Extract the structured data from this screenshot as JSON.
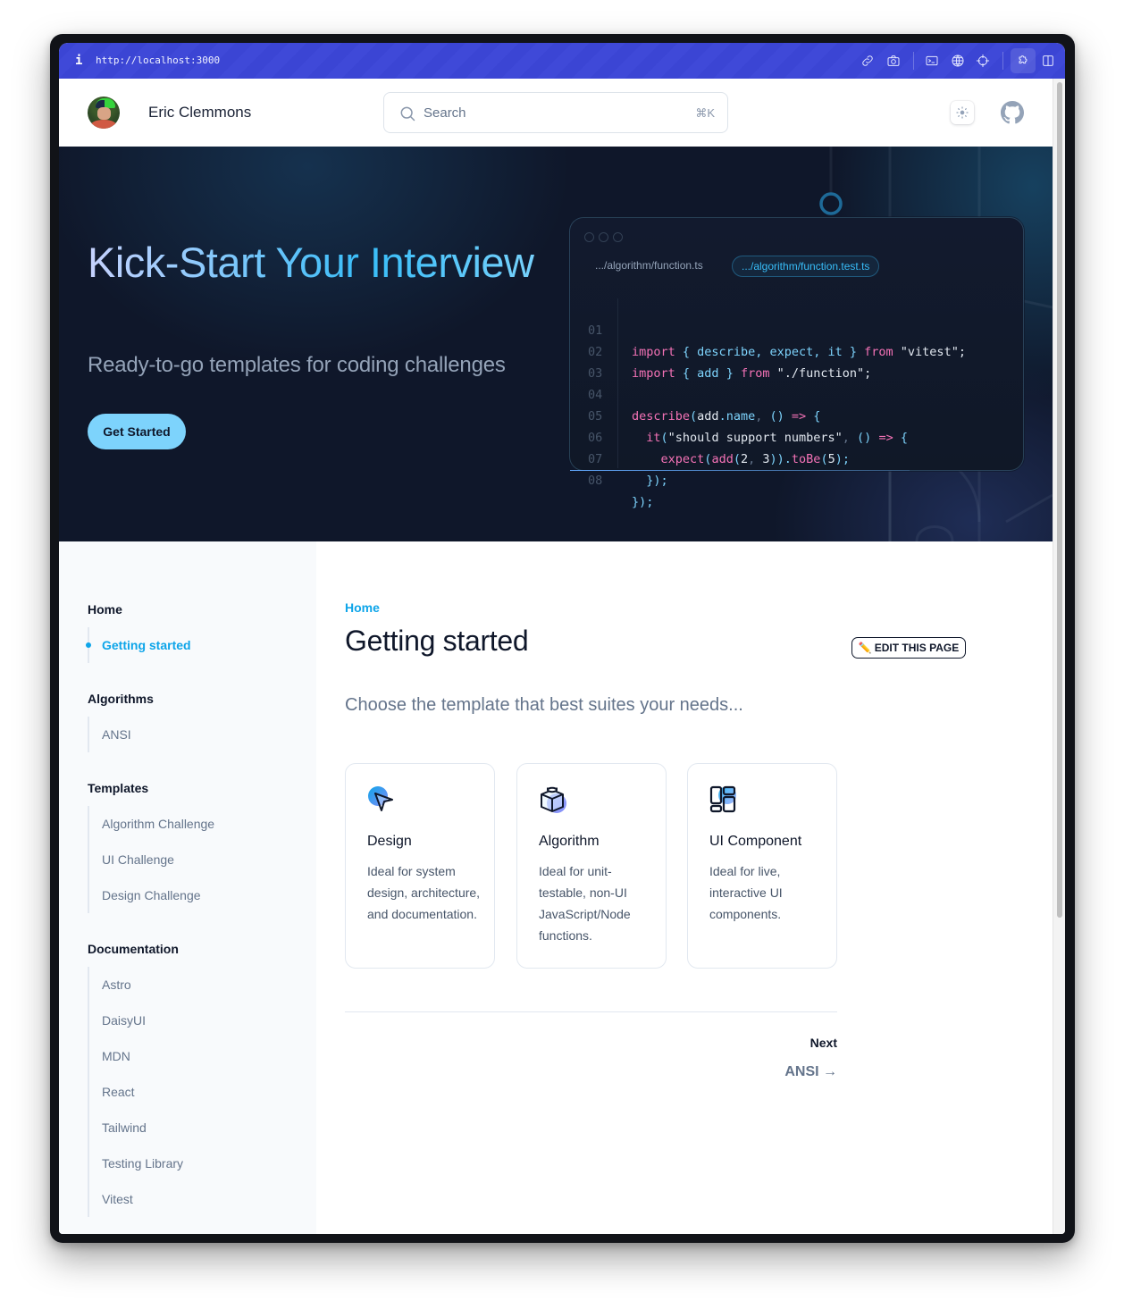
{
  "browser": {
    "url": "http://localhost:3000",
    "toolbar_icons": [
      "link-icon",
      "camera-icon",
      "terminal-icon",
      "globe-icon",
      "crosshair-icon",
      "extension-icon",
      "split-view-icon"
    ]
  },
  "header": {
    "site_name": "Eric Clemmons",
    "search_placeholder": "Search",
    "search_shortcut": "⌘K"
  },
  "hero": {
    "title": "Kick-Start Your Interview",
    "subtitle": "Ready-to-go templates for coding challenges",
    "cta_label": "Get Started",
    "code_card": {
      "tabs": [
        {
          "label": ".../algorithm/function.ts",
          "active": false
        },
        {
          "label": ".../algorithm/function.test.ts",
          "active": true
        }
      ],
      "line_numbers": [
        "01",
        "02",
        "03",
        "04",
        "05",
        "06",
        "07",
        "08"
      ],
      "lines": [
        "import { describe, expect, it } from \"vitest\";",
        "import { add } from \"./function\";",
        "",
        "describe(add.name, () => {",
        "  it(\"should support numbers\", () => {",
        "    expect(add(2, 3)).toBe(5);",
        "  });",
        "});"
      ]
    }
  },
  "sidebar": {
    "groups": [
      {
        "title": "Home",
        "items": [
          {
            "label": "Getting started",
            "active": true
          }
        ]
      },
      {
        "title": "Algorithms",
        "items": [
          {
            "label": "ANSI"
          }
        ]
      },
      {
        "title": "Templates",
        "items": [
          {
            "label": "Algorithm Challenge"
          },
          {
            "label": "UI Challenge"
          },
          {
            "label": "Design Challenge"
          }
        ]
      },
      {
        "title": "Documentation",
        "items": [
          {
            "label": "Astro"
          },
          {
            "label": "DaisyUI"
          },
          {
            "label": "MDN"
          },
          {
            "label": "React"
          },
          {
            "label": "Tailwind"
          },
          {
            "label": "Testing Library"
          },
          {
            "label": "Vitest"
          }
        ]
      }
    ]
  },
  "main": {
    "breadcrumb": "Home",
    "title": "Getting started",
    "edit_label": "EDIT THIS PAGE",
    "edit_emoji": "✏️",
    "lead": "Choose the template that best suites your needs...",
    "cards": [
      {
        "title": "Design",
        "description": "Ideal for system design, architecture, and documentation.",
        "icon": "cursor-icon"
      },
      {
        "title": "Algorithm",
        "description": "Ideal for unit-testable, non-UI JavaScript/Node functions.",
        "icon": "cube-icon"
      },
      {
        "title": "UI Component",
        "description": "Ideal for live, interactive UI components.",
        "icon": "layout-icon"
      }
    ],
    "pagination": {
      "next_label": "Next",
      "next_link": "ANSI →"
    }
  },
  "colors": {
    "accent": "#0ea5e9",
    "browser_bar": "#3b45d4",
    "hero_bg": "#0f172a",
    "cta": "#7dd3fc",
    "code_keyword": "#f472b6",
    "code_identifier": "#7dd3fc"
  }
}
